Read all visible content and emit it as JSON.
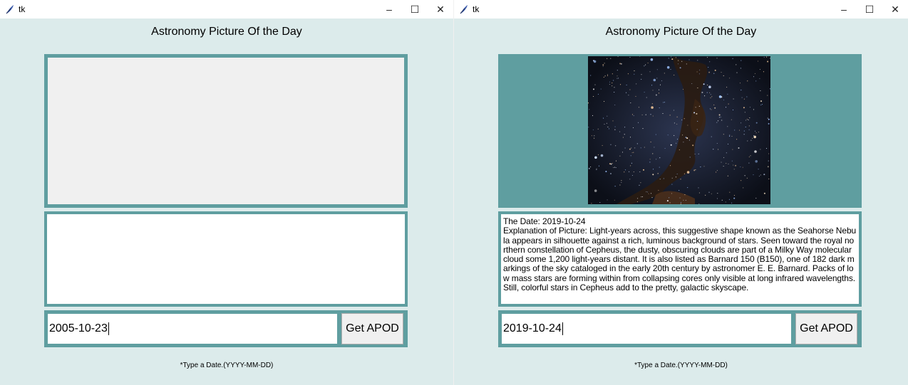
{
  "left_window": {
    "title": "tk",
    "controls": {
      "minimize": "–",
      "maximize": "☐",
      "close": "✕"
    },
    "app_title": "Astronomy Picture Of the Day",
    "date_value": "2005-10-23",
    "button_label": "Get APOD",
    "hint": "*Type a Date.(YYYY-MM-DD)"
  },
  "right_window": {
    "title": "tk",
    "controls": {
      "minimize": "–",
      "maximize": "☐",
      "close": "✕"
    },
    "app_title": "Astronomy Picture Of the Day",
    "description": {
      "date_line": "The Date: 2019-10-24",
      "explanation": "Explanation of Picture: Light-years across, this suggestive shape known as the Seahorse Nebula appears in silhouette against a rich, luminous background of stars. Seen toward the royal northern constellation of Cepheus, the dusty, obscuring clouds are part of a Milky Way molecular cloud some 1,200 light-years distant. It is also listed as Barnard 150 (B150), one of 182 dark markings of the sky cataloged in the early 20th century by astronomer E. E. Barnard. Packs of low mass stars are forming within from collapsing cores only visible at long infrared wavelengths. Still, colorful stars in Cepheus add to the pretty, galactic skyscape."
    },
    "date_value": "2019-10-24",
    "button_label": "Get APOD",
    "hint": "*Type a Date.(YYYY-MM-DD)"
  },
  "colors": {
    "window_bg": "#dcebeb",
    "frame": "#5f9ea0",
    "panel_empty": "#f0f0f0",
    "panel_text": "#ffffff"
  },
  "icons": {
    "app_icon": "tk-feather-icon",
    "photo": "seahorse-nebula-photo"
  }
}
